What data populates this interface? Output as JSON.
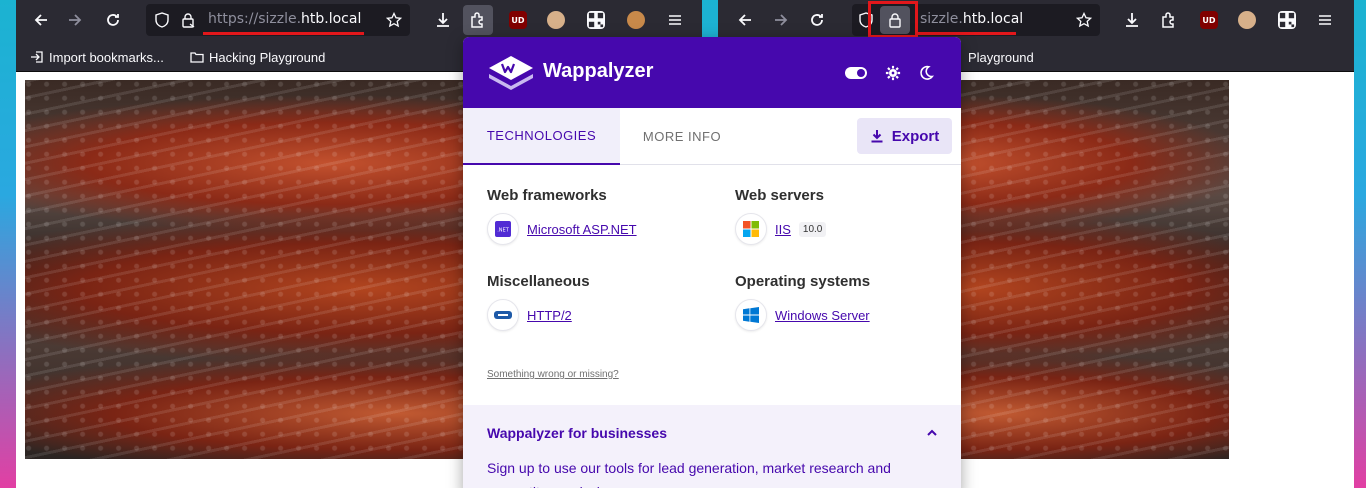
{
  "left_window": {
    "url": {
      "protocol": "https://",
      "subdomain": "sizzle.",
      "domain": "htb.local"
    },
    "bookmarks": [
      {
        "label": "Import bookmarks..."
      },
      {
        "label": "Hacking Playground"
      }
    ]
  },
  "right_window": {
    "url": {
      "subdomain": "sizzle.",
      "domain": "htb.local"
    },
    "bookmarks": [
      {
        "label": "Playground"
      }
    ]
  },
  "extensions": {
    "ublock": "UD"
  },
  "wappalyzer": {
    "brand": "Wappalyzer",
    "tabs": [
      "TECHNOLOGIES",
      "MORE INFO"
    ],
    "export_label": "Export",
    "categories": [
      {
        "name": "Web frameworks",
        "tech": "Microsoft ASP.NET",
        "icon": "dotnet-icon"
      },
      {
        "name": "Web servers",
        "tech": "IIS",
        "version": "10.0",
        "icon": "windows-logo-icon"
      },
      {
        "name": "Miscellaneous",
        "tech": "HTTP/2",
        "icon": "http2-icon"
      },
      {
        "name": "Operating systems",
        "tech": "Windows Server",
        "icon": "windows-blue-icon"
      }
    ],
    "feedback_link": "Something wrong or missing?",
    "business": {
      "title": "Wappalyzer for businesses",
      "body": "Sign up to use our tools for lead generation, market research and competitor analysis."
    }
  },
  "colors": {
    "wappalyzer_purple": "#4608ad",
    "firefox_toolbar": "#2b2a33",
    "highlight_red": "#e2171b"
  }
}
